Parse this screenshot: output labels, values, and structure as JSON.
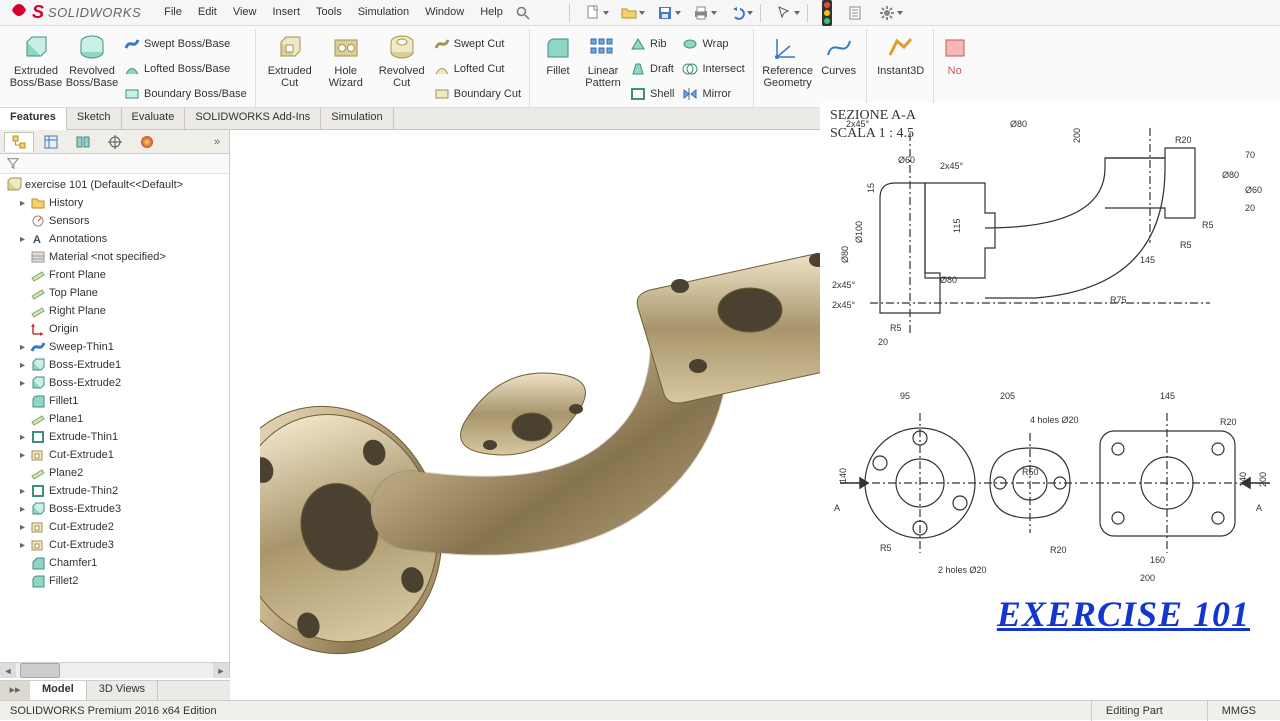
{
  "app": {
    "logo_text": "SOLIDWORKS"
  },
  "menus": [
    "File",
    "Edit",
    "View",
    "Insert",
    "Tools",
    "Simulation",
    "Window",
    "Help"
  ],
  "ribbon": {
    "extruded_boss": "Extruded\nBoss/Base",
    "revolved_boss": "Revolved\nBoss/Base",
    "swept_boss": "Swept Boss/Base",
    "lofted_boss": "Lofted Boss/Base",
    "boundary_boss": "Boundary Boss/Base",
    "extruded_cut": "Extruded\nCut",
    "hole_wizard": "Hole\nWizard",
    "revolved_cut": "Revolved\nCut",
    "swept_cut": "Swept Cut",
    "lofted_cut": "Lofted Cut",
    "boundary_cut": "Boundary Cut",
    "fillet": "Fillet",
    "linear_pattern": "Linear\nPattern",
    "rib": "Rib",
    "draft": "Draft",
    "shell": "Shell",
    "wrap": "Wrap",
    "intersect": "Intersect",
    "mirror": "Mirror",
    "ref_geom": "Reference\nGeometry",
    "curves": "Curves",
    "instant3d": "Instant3D",
    "truncated": "No"
  },
  "tabs": [
    "Features",
    "Sketch",
    "Evaluate",
    "SOLIDWORKS Add-Ins",
    "Simulation"
  ],
  "tree": {
    "root": "exercise 101  (Default<<Default>",
    "items": [
      {
        "label": "History",
        "exp": true
      },
      {
        "label": "Sensors",
        "exp": false
      },
      {
        "label": "Annotations",
        "exp": true
      },
      {
        "label": "Material <not specified>",
        "exp": false
      },
      {
        "label": "Front Plane",
        "exp": false
      },
      {
        "label": "Top Plane",
        "exp": false
      },
      {
        "label": "Right Plane",
        "exp": false
      },
      {
        "label": "Origin",
        "exp": false
      },
      {
        "label": "Sweep-Thin1",
        "exp": true
      },
      {
        "label": "Boss-Extrude1",
        "exp": true
      },
      {
        "label": "Boss-Extrude2",
        "exp": true
      },
      {
        "label": "Fillet1",
        "exp": false
      },
      {
        "label": "Plane1",
        "exp": false
      },
      {
        "label": "Extrude-Thin1",
        "exp": true
      },
      {
        "label": "Cut-Extrude1",
        "exp": true
      },
      {
        "label": "Plane2",
        "exp": false
      },
      {
        "label": "Extrude-Thin2",
        "exp": true
      },
      {
        "label": "Boss-Extrude3",
        "exp": true
      },
      {
        "label": "Cut-Extrude2",
        "exp": true
      },
      {
        "label": "Cut-Extrude3",
        "exp": true
      },
      {
        "label": "Chamfer1",
        "exp": false
      },
      {
        "label": "Fillet2",
        "exp": false
      }
    ]
  },
  "bottom_tabs": [
    "Model",
    "3D Views"
  ],
  "drawing": {
    "title_line1": "SEZIONE A-A",
    "title_line2": "SCALA 1 : 4.5",
    "dims_section": [
      "2x45°",
      "Ø80",
      "R20",
      "Ø60",
      "Ø80",
      "70",
      "R5",
      "200",
      "2x45°",
      "Ø60",
      "20",
      "15",
      "115",
      "R5",
      "145",
      "Ø80",
      "2x45°",
      "Ø80",
      "Ø100",
      "2x45°",
      "R5",
      "R75",
      "20"
    ],
    "dims_top": [
      "95",
      "205",
      "145",
      "4 holes Ø20",
      "R20",
      "140",
      "R50",
      "140",
      "200",
      "A",
      "A",
      "R5",
      "2 holes Ø20",
      "R20",
      "160",
      "200"
    ],
    "exercise_label": "EXERCISE 101"
  },
  "status": {
    "left": "SOLIDWORKS Premium 2016 x64 Edition",
    "editing": "Editing Part",
    "units": "MMGS"
  }
}
